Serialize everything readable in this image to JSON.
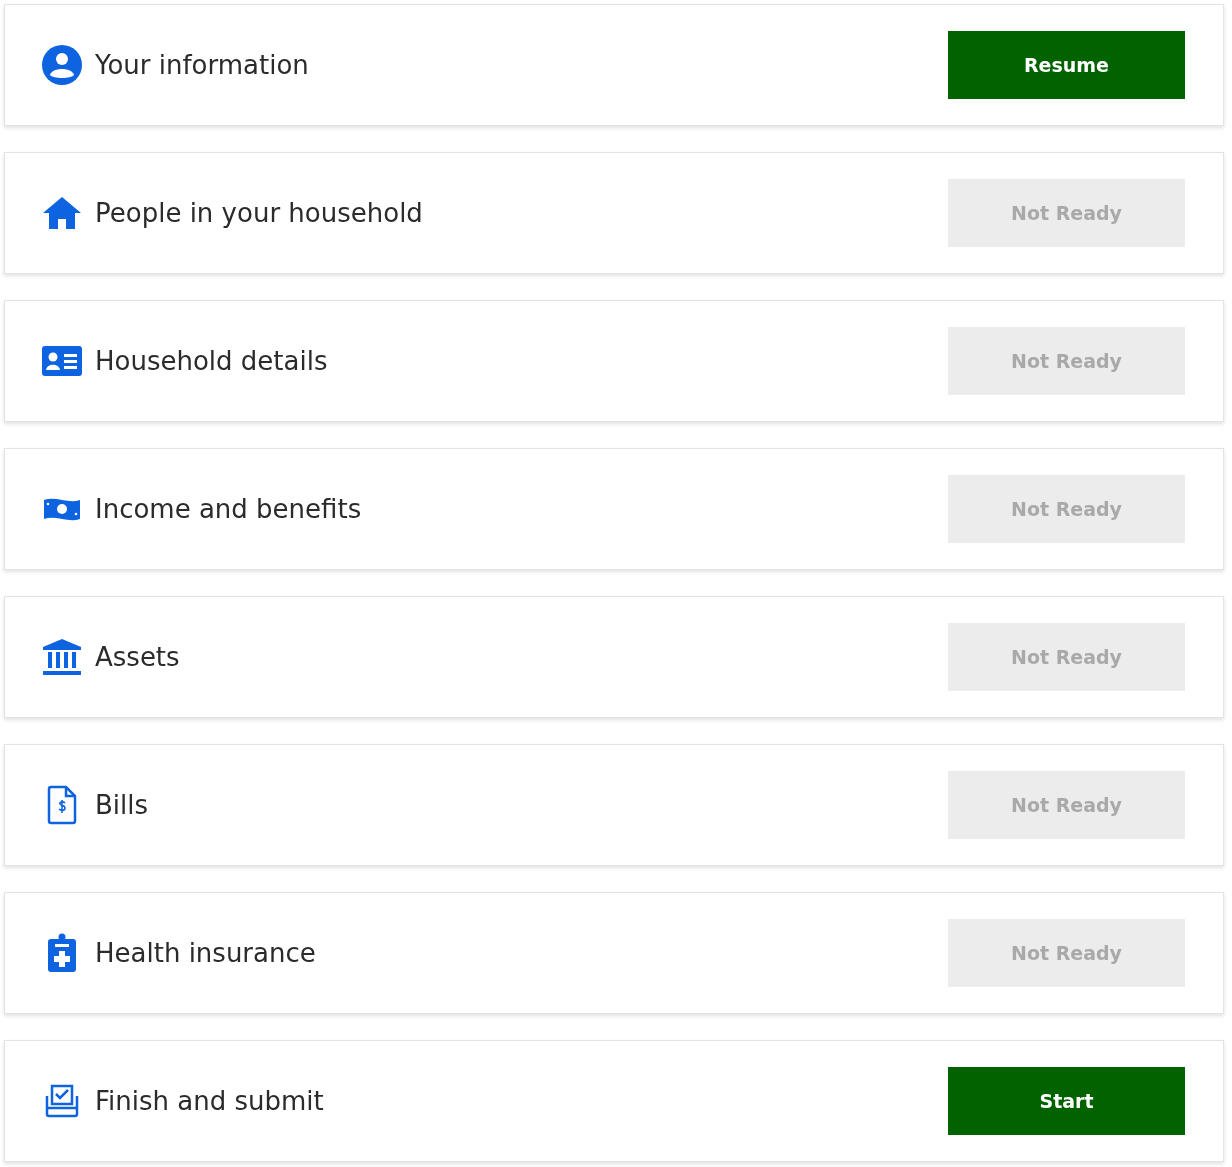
{
  "sections": [
    {
      "title": "Your information",
      "button": "Resume",
      "disabled": false
    },
    {
      "title": "People in your household",
      "button": "Not Ready",
      "disabled": true
    },
    {
      "title": "Household details",
      "button": "Not Ready",
      "disabled": true
    },
    {
      "title": "Income and benefits",
      "button": "Not Ready",
      "disabled": true
    },
    {
      "title": "Assets",
      "button": "Not Ready",
      "disabled": true
    },
    {
      "title": "Bills",
      "button": "Not Ready",
      "disabled": true
    },
    {
      "title": "Health insurance",
      "button": "Not Ready",
      "disabled": true
    },
    {
      "title": "Finish and submit",
      "button": "Start",
      "disabled": false
    }
  ]
}
